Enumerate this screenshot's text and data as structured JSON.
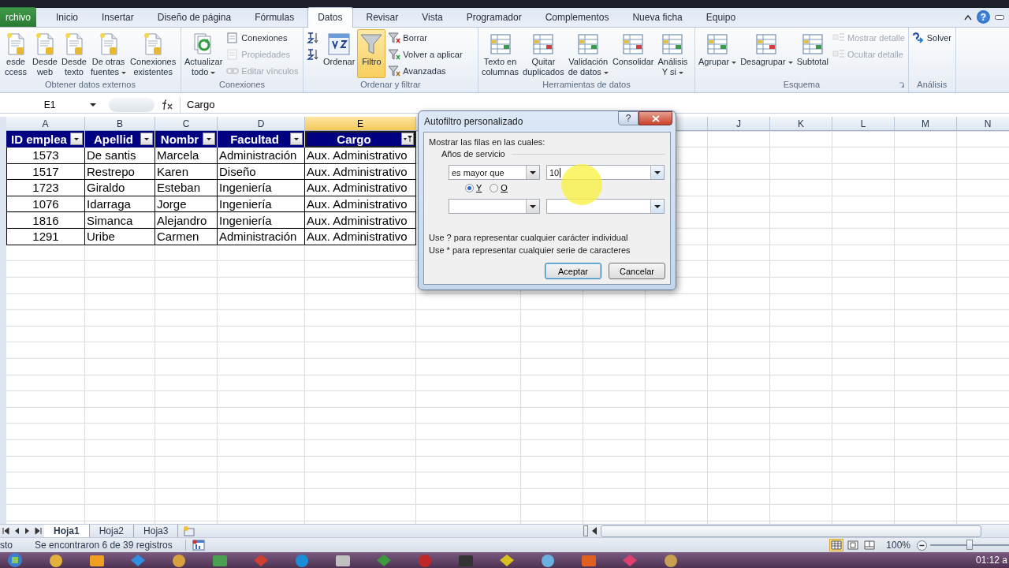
{
  "tabs": [
    {
      "label": "rchivo",
      "kind": "file",
      "selected": false
    },
    {
      "label": "Inicio",
      "kind": "tab",
      "selected": false
    },
    {
      "label": "Insertar",
      "kind": "tab",
      "selected": false
    },
    {
      "label": "Diseño de página",
      "kind": "tab",
      "selected": false
    },
    {
      "label": "Fórmulas",
      "kind": "tab",
      "selected": false
    },
    {
      "label": "Datos",
      "kind": "tab",
      "selected": true
    },
    {
      "label": "Revisar",
      "kind": "tab",
      "selected": false
    },
    {
      "label": "Vista",
      "kind": "tab",
      "selected": false
    },
    {
      "label": "Programador",
      "kind": "tab",
      "selected": false
    },
    {
      "label": "Complementos",
      "kind": "tab",
      "selected": false
    },
    {
      "label": "Nueva ficha",
      "kind": "tab",
      "selected": false
    },
    {
      "label": "Equipo",
      "kind": "tab",
      "selected": false
    }
  ],
  "window_controls": {
    "help": "?"
  },
  "ribbon": {
    "groups": [
      {
        "label": "Obtener datos externos",
        "launcher": false,
        "items": [
          {
            "kind": "large",
            "label": "esde\nccess",
            "menu": false,
            "active": false
          },
          {
            "kind": "large",
            "label": "Desde\nweb",
            "menu": false,
            "active": false
          },
          {
            "kind": "large",
            "label": "Desde\ntexto",
            "menu": false,
            "active": false
          },
          {
            "kind": "large",
            "label": "De otras\nfuentes",
            "menu": true,
            "active": false
          },
          {
            "kind": "large",
            "label": "Conexiones\nexistentes",
            "menu": false,
            "active": false
          }
        ]
      },
      {
        "label": "Conexiones",
        "launcher": false,
        "items": [
          {
            "kind": "large",
            "label": "Actualizar\ntodo",
            "menu": true,
            "active": false
          },
          {
            "kind": "stack",
            "items": [
              {
                "label": "Conexiones",
                "disabled": false
              },
              {
                "label": "Propiedades",
                "disabled": true
              },
              {
                "label": "Editar vínculos",
                "disabled": true
              }
            ]
          }
        ]
      },
      {
        "label": "Ordenar y filtrar",
        "launcher": false,
        "items": [
          {
            "kind": "stack",
            "items": [
              {
                "disabled": false
              },
              {
                "disabled": false
              }
            ]
          },
          {
            "kind": "large",
            "label": "Ordenar",
            "menu": false,
            "active": false
          },
          {
            "kind": "large",
            "label": "Filtro",
            "menu": false,
            "active": true
          },
          {
            "kind": "stack",
            "items": [
              {
                "label": "Borrar",
                "disabled": false
              },
              {
                "label": "Volver a aplicar",
                "disabled": false
              },
              {
                "label": "Avanzadas",
                "disabled": false
              }
            ]
          }
        ]
      },
      {
        "label": "Herramientas de datos",
        "launcher": false,
        "items": [
          {
            "kind": "large",
            "label": "Texto en\ncolumnas",
            "menu": false,
            "active": false
          },
          {
            "kind": "large",
            "label": "Quitar\nduplicados",
            "menu": false,
            "active": false
          },
          {
            "kind": "large",
            "label": "Validación\nde datos",
            "menu": true,
            "active": false
          },
          {
            "kind": "large",
            "label": "Consolidar",
            "menu": false,
            "active": false
          },
          {
            "kind": "large",
            "label": "Análisis\nY si",
            "menu": true,
            "active": false
          }
        ]
      },
      {
        "label": "Esquema",
        "launcher": true,
        "items": [
          {
            "kind": "large",
            "label": "Agrupar",
            "menu": true,
            "active": false
          },
          {
            "kind": "large",
            "label": "Desagrupar",
            "menu": true,
            "active": false
          },
          {
            "kind": "large",
            "label": "Subtotal",
            "menu": false,
            "active": false
          },
          {
            "kind": "stack",
            "items": [
              {
                "label": "Mostrar detalle",
                "disabled": true
              },
              {
                "label": "Ocultar detalle",
                "disabled": true
              }
            ]
          }
        ]
      },
      {
        "label": "Análisis",
        "launcher": false,
        "items": [
          {
            "kind": "stack",
            "items": [
              {
                "label": "Solver",
                "disabled": false
              }
            ]
          }
        ]
      }
    ]
  },
  "formula_bar": {
    "name_box": "E1",
    "formula": "Cargo"
  },
  "sheet": {
    "columns": [
      {
        "label": "A",
        "selected": false
      },
      {
        "label": "B",
        "selected": false
      },
      {
        "label": "C",
        "selected": false
      },
      {
        "label": "D",
        "selected": false
      },
      {
        "label": "E",
        "selected": true
      },
      {
        "label": "J",
        "selected": false
      },
      {
        "label": "K",
        "selected": false
      },
      {
        "label": "L",
        "selected": false
      },
      {
        "label": "M",
        "selected": false
      },
      {
        "label": "N",
        "selected": false
      }
    ],
    "header": [
      {
        "text": "ID emplea",
        "filtered": false
      },
      {
        "text": "Apellid",
        "filtered": false
      },
      {
        "text": "Nombr",
        "filtered": false
      },
      {
        "text": "Facultad",
        "filtered": false
      },
      {
        "text": "Cargo",
        "filtered": true
      }
    ],
    "rows": [
      [
        "1573",
        "De santis",
        "Marcela",
        "Administración",
        "Aux. Administrativo"
      ],
      [
        "1517",
        "Restrepo",
        "Karen",
        "Diseño",
        "Aux. Administrativo"
      ],
      [
        "1723",
        "Giraldo",
        "Esteban",
        "Ingeniería",
        "Aux. Administrativo"
      ],
      [
        "1076",
        "Idarraga",
        "Jorge",
        "Ingeniería",
        "Aux. Administrativo"
      ],
      [
        "1816",
        "Simanca",
        "Alejandro",
        "Ingeniería",
        "Aux. Administrativo"
      ],
      [
        "1291",
        "Uribe",
        "Carmen",
        "Administración",
        "Aux. Administrativo"
      ]
    ]
  },
  "dialog": {
    "title": "Autofiltro personalizado",
    "help": "?",
    "prompt": "Mostrar las filas en las cuales:",
    "field": "Años de servicio",
    "conditions": [
      {
        "operator": "es mayor que",
        "value": "10"
      }
    ],
    "join": [
      {
        "label": "Y",
        "selected": true
      },
      {
        "label": "O",
        "selected": false
      }
    ],
    "hints": [
      "Use ? para representar cualquier carácter individual",
      "Use * para representar cualquier serie de caracteres"
    ],
    "buttons": [
      {
        "label": "Aceptar",
        "default": true
      },
      {
        "label": "Cancelar",
        "default": false
      }
    ]
  },
  "sheet_tabs": [
    {
      "label": "Hoja1",
      "selected": true
    },
    {
      "label": "Hoja2",
      "selected": false
    },
    {
      "label": "Hoja3",
      "selected": false
    }
  ],
  "status_bar": {
    "mode": "sto",
    "message": "Se encontraron 6 de 39 registros",
    "views": [
      {
        "selected": true
      },
      {
        "selected": false
      },
      {
        "selected": false
      }
    ],
    "zoom": "100%",
    "zoom_slider": {
      "level": 0.5
    }
  },
  "taskbar": {
    "clock": "01:12 a"
  }
}
